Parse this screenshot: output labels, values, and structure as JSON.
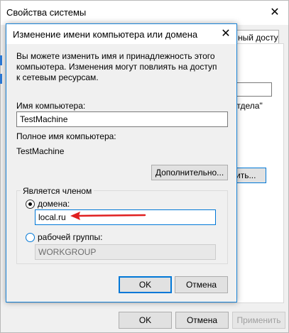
{
  "back_window": {
    "title": "Свойства системы",
    "tab_label": "ный доступ",
    "dept_text": "отдела\"",
    "change_button": "ить...",
    "ok": "OK",
    "cancel": "Отмена",
    "apply": "Применить",
    "close_glyph": "✕"
  },
  "dialog": {
    "title": "Изменение имени компьютера или домена",
    "close_glyph": "✕",
    "intro": "Вы можете изменить имя и принадлежность этого компьютера. Изменения могут повлиять на доступ к сетевым ресурсам.",
    "computer_name_label": "Имя компьютера:",
    "computer_name_value": "TestMachine",
    "full_name_label": "Полное имя компьютера:",
    "full_name_value": "TestMachine",
    "more_button": "Дополнительно...",
    "member_of": {
      "legend": "Является членом",
      "domain_label": "домена:",
      "domain_value": "local.ru",
      "domain_selected": true,
      "workgroup_label": "рабочей группы:",
      "workgroup_value": "WORKGROUP"
    },
    "ok": "OK",
    "cancel": "Отмена"
  },
  "colors": {
    "accent": "#0078d7",
    "annotation_arrow": "#e02020"
  }
}
